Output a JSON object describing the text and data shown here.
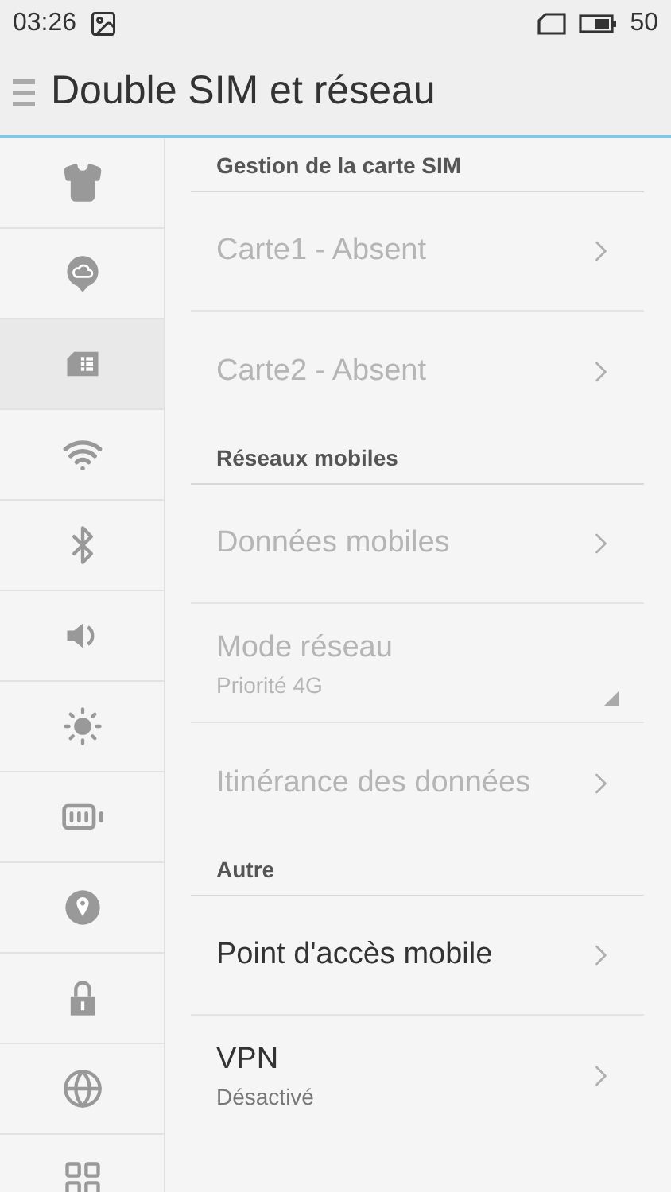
{
  "status_bar": {
    "time": "03:26",
    "battery": "50"
  },
  "header": {
    "title": "Double SIM et réseau"
  },
  "sidebar": {
    "items": [
      {
        "selected": false
      },
      {
        "selected": false
      },
      {
        "selected": true
      },
      {
        "selected": false
      },
      {
        "selected": false
      },
      {
        "selected": false
      },
      {
        "selected": false
      },
      {
        "selected": false
      },
      {
        "selected": false
      },
      {
        "selected": false
      },
      {
        "selected": false
      },
      {
        "selected": false
      }
    ]
  },
  "sections": [
    {
      "title": "Gestion de la carte SIM",
      "items": [
        {
          "kind": "link",
          "label": "Carte1 - Absent",
          "disabled": true
        },
        {
          "kind": "link",
          "label": "Carte2 - Absent",
          "disabled": true
        }
      ]
    },
    {
      "title": "Réseaux mobiles",
      "items": [
        {
          "kind": "link",
          "label": "Données mobiles",
          "disabled": true
        },
        {
          "kind": "dropdown",
          "label": "Mode réseau",
          "value": "Priorité 4G",
          "disabled": true
        },
        {
          "kind": "link",
          "label": "Itinérance des données",
          "disabled": true
        }
      ]
    },
    {
      "title": "Autre",
      "items": [
        {
          "kind": "link",
          "label": "Point d'accès mobile",
          "disabled": false
        },
        {
          "kind": "link",
          "label": "VPN",
          "value": "Désactivé",
          "disabled": false
        }
      ]
    }
  ]
}
